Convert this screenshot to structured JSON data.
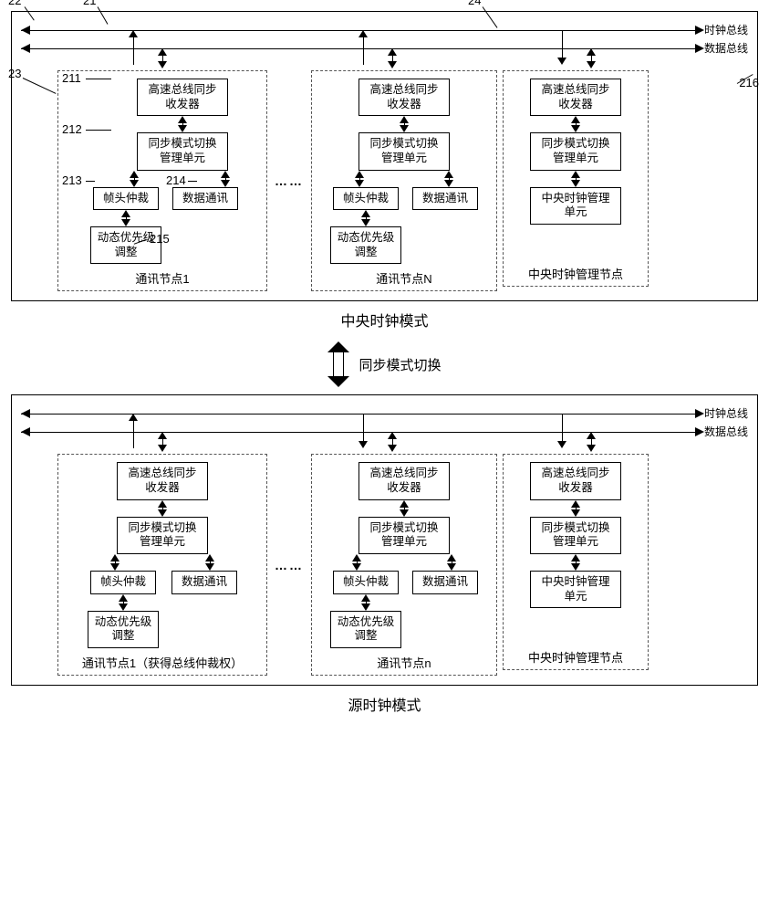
{
  "bus": {
    "clock": "时钟总线",
    "data": "数据总线"
  },
  "refs": {
    "r22": "22",
    "r21": "21",
    "r24": "24",
    "r23": "23",
    "r211": "211",
    "r212": "212",
    "r213": "213",
    "r214": "214",
    "r215": "215",
    "r216": "216"
  },
  "units": {
    "transceiver": "高速总线同步收发器",
    "mode_switch": "同步模式切换管理单元",
    "frame_arb": "帧头仲裁",
    "data_comm": "数据通讯",
    "dyn_prio": "动态优先级调整",
    "central_clk_mgr": "中央时钟管理单元"
  },
  "node_titles": {
    "node1": "通讯节点1",
    "nodeN": "通讯节点N",
    "noden": "通讯节点n",
    "clock_node": "中央时钟管理节点",
    "node1_arb": "通讯节点1（获得总线仲裁权）"
  },
  "modes": {
    "central": "中央时钟模式",
    "source": "源时钟模式",
    "switch_label": "同步模式切换"
  },
  "ellipsis": "……",
  "chart_data": {
    "type": "diagram",
    "description": "Two bus-synchronization modes (central-clock and source-clock) sharing a clock bus and a data bus. Each communication node contains: high-speed bus sync transceiver → sync-mode switch management unit → (frame-header arbitration ↔ dynamic priority adjustment) and data communication. A central clock management node contains transceiver → mode-switch unit → central clock management unit. A double arrow labeled 同步模式切换 connects the two mode panels.",
    "reference_numbers": {
      "21": "时钟总线 (clock bus line)",
      "22": "数据总线 (data bus line, outer)",
      "23": "通讯节点1 container",
      "24": "数据总线 (upper panel, right side indicator)",
      "211": "高速总线同步收发器",
      "212": "同步模式切换管理单元",
      "213": "帧头仲裁",
      "214": "数据通讯",
      "215": "动态优先级调整",
      "216": "中央时钟管理单元"
    },
    "panels": [
      {
        "mode": "中央时钟模式",
        "nodes": [
          {
            "name": "通讯节点1",
            "units": [
              "高速总线同步收发器",
              "同步模式切换管理单元",
              "帧头仲裁",
              "数据通讯",
              "动态优先级调整"
            ]
          },
          {
            "name": "通讯节点N",
            "units": [
              "高速总线同步收发器",
              "同步模式切换管理单元",
              "帧头仲裁",
              "数据通讯",
              "动态优先级调整"
            ]
          },
          {
            "name": "中央时钟管理节点",
            "units": [
              "高速总线同步收发器",
              "同步模式切换管理单元",
              "中央时钟管理单元"
            ],
            "drives_clock_bus": true
          }
        ]
      },
      {
        "mode": "源时钟模式",
        "nodes": [
          {
            "name": "通讯节点1（获得总线仲裁权）",
            "units": [
              "高速总线同步收发器",
              "同步模式切换管理单元",
              "帧头仲裁",
              "数据通讯",
              "动态优先级调整"
            ],
            "drives_clock_bus": true
          },
          {
            "name": "通讯节点n",
            "units": [
              "高速总线同步收发器",
              "同步模式切换管理单元",
              "帧头仲裁",
              "数据通讯",
              "动态优先级调整"
            ]
          },
          {
            "name": "中央时钟管理节点",
            "units": [
              "高速总线同步收发器",
              "同步模式切换管理单元",
              "中央时钟管理单元"
            ]
          }
        ]
      }
    ]
  }
}
